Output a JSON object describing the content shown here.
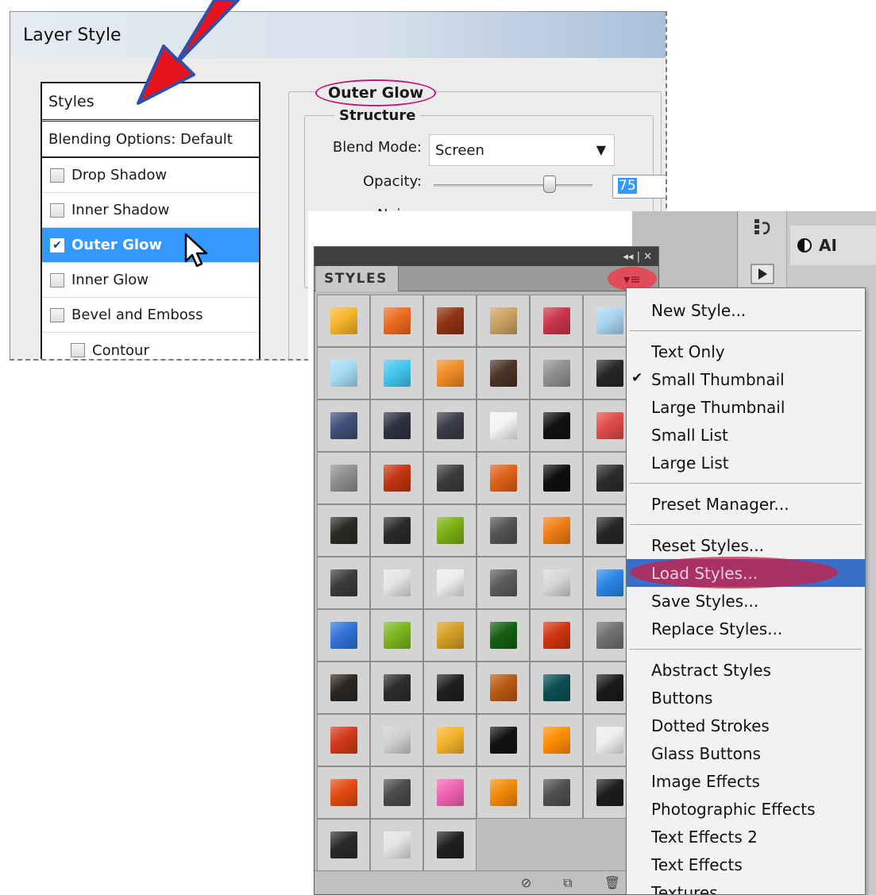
{
  "dialog": {
    "title": "Layer Style",
    "styles_header": "Styles",
    "blending_options": "Blending Options: Default",
    "style_items": [
      {
        "label": "Drop Shadow",
        "checked": false,
        "selected": false
      },
      {
        "label": "Inner Shadow",
        "checked": false,
        "selected": false
      },
      {
        "label": "Outer Glow",
        "checked": true,
        "selected": true
      },
      {
        "label": "Inner Glow",
        "checked": false,
        "selected": false
      },
      {
        "label": "Bevel and Emboss",
        "checked": false,
        "selected": false
      },
      {
        "label": "Contour",
        "checked": false,
        "selected": false
      }
    ],
    "section_title": "Outer Glow",
    "structure_title": "Structure",
    "blend_mode_label": "Blend Mode:",
    "blend_mode_value": "Screen",
    "opacity_label": "Opacity:",
    "opacity_value": "75",
    "noise_label": "Noise:"
  },
  "styles_panel": {
    "tab_label": "STYLES",
    "panel_controls": "◂◂ | ✕",
    "swatches": [
      "#f6b52a",
      "#ee6a1f",
      "#8e3313",
      "#c9a263",
      "#c9344a",
      "#a9d4f2",
      "#a5dcf4",
      "#42c6ee",
      "#f08c26",
      "#4b3424",
      "#8f8f8f",
      "#262626",
      "#3f4f78",
      "#2f3142",
      "#3a3c47",
      "#f4f4f4",
      "#111111",
      "#e04b4b",
      "#8e8e8e",
      "#c33512",
      "#3c3c3c",
      "#de6118",
      "#0e0e0e",
      "#2c2c2c",
      "#2c2a27",
      "#2a2a2a",
      "#7bb014",
      "#535353",
      "#f07c16",
      "#262626",
      "#3b3b3b",
      "#e4e4e4",
      "#ececec",
      "#5c5c5c",
      "#d7d7d7",
      "#2b86e6",
      "#2f72d8",
      "#7db51f",
      "#d59f25",
      "#145f12",
      "#cf3411",
      "#707070",
      "#2a2623",
      "#2c2c2c",
      "#1f1f1f",
      "#b85a12",
      "#0c4f52",
      "#1a1a1a",
      "#d13a19",
      "#cfcfcf",
      "#f5b32c",
      "#121212",
      "#ff8c00",
      "#eeeeee",
      "#e34a10",
      "#4a4a4a",
      "#ef62b0",
      "#f38a08",
      "#4f4f4f",
      "#1d1d1d",
      "#2a2a2a",
      "#e3e3e3",
      "#202020"
    ]
  },
  "menu": {
    "items": [
      {
        "label": "New Style...",
        "type": "item"
      },
      {
        "type": "sep"
      },
      {
        "label": "Text Only",
        "type": "item"
      },
      {
        "label": "Small Thumbnail",
        "type": "item",
        "checked": true
      },
      {
        "label": "Large Thumbnail",
        "type": "item"
      },
      {
        "label": "Small List",
        "type": "item"
      },
      {
        "label": "Large List",
        "type": "item"
      },
      {
        "type": "sep"
      },
      {
        "label": "Preset Manager...",
        "type": "item"
      },
      {
        "type": "sep"
      },
      {
        "label": "Reset Styles...",
        "type": "item"
      },
      {
        "label": "Load Styles...",
        "type": "item",
        "highlighted": true
      },
      {
        "label": "Save Styles...",
        "type": "item"
      },
      {
        "label": "Replace Styles...",
        "type": "item"
      },
      {
        "type": "sep"
      },
      {
        "label": "Abstract Styles",
        "type": "item"
      },
      {
        "label": "Buttons",
        "type": "item"
      },
      {
        "label": "Dotted Strokes",
        "type": "item"
      },
      {
        "label": "Glass Buttons",
        "type": "item"
      },
      {
        "label": "Image Effects",
        "type": "item"
      },
      {
        "label": "Photographic Effects",
        "type": "item"
      },
      {
        "label": "Text Effects 2",
        "type": "item"
      },
      {
        "label": "Text Effects",
        "type": "item"
      },
      {
        "label": "Textures",
        "type": "item"
      }
    ]
  },
  "side_panel": {
    "adjustments_abbrev": "AI"
  },
  "colors": {
    "selection_blue": "#3399ff",
    "highlight_oval": "#c2187d",
    "arrow_red": "#e8141b",
    "arrow_outline": "#2f4fa8"
  }
}
